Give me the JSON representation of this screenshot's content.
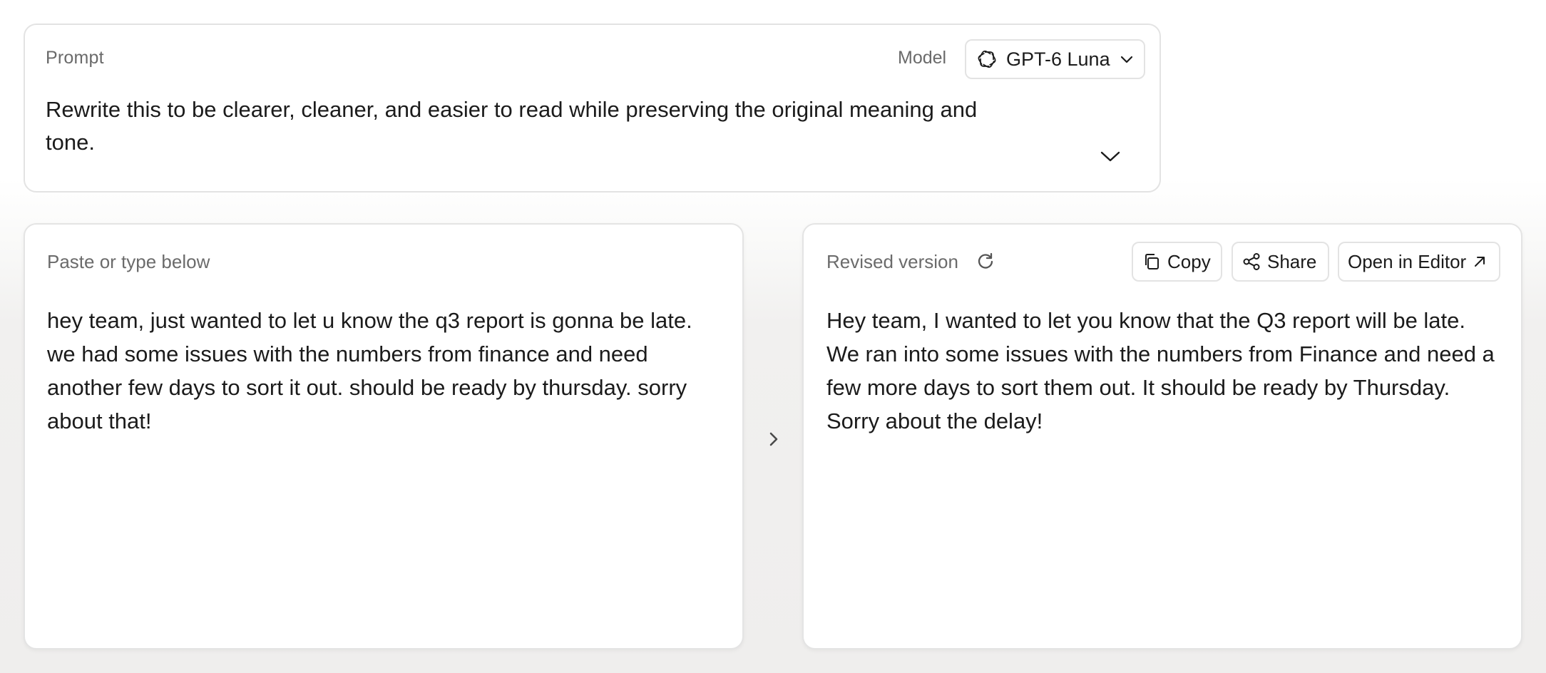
{
  "prompt": {
    "label": "Prompt",
    "text": "Rewrite this to be clearer, cleaner, and easier to read while preserving the original meaning and tone."
  },
  "model": {
    "label": "Model",
    "selected": "GPT-6 Luna",
    "icon": "openai-logo-icon"
  },
  "input_panel": {
    "header": "Paste or type below",
    "text": "hey team, just wanted to let u know the q3 report is gonna be late. we had some issues with the numbers from finance and need another few days to sort it out. should be ready by thursday. sorry about that!"
  },
  "output_panel": {
    "header": "Revised version",
    "text": "Hey team, I wanted to let you know that the Q3 report will be late. We ran into some issues with the numbers from Finance and need a few more days to sort them out. It should be ready by Thursday. Sorry about the delay!",
    "actions": {
      "copy": "Copy",
      "share": "Share",
      "open_in_editor": "Open in Editor"
    }
  },
  "colors": {
    "border": "#e3e3e3",
    "muted_text": "#6a6a6a",
    "body_text": "#1b1b1b",
    "background_lower": "#efeeed"
  }
}
